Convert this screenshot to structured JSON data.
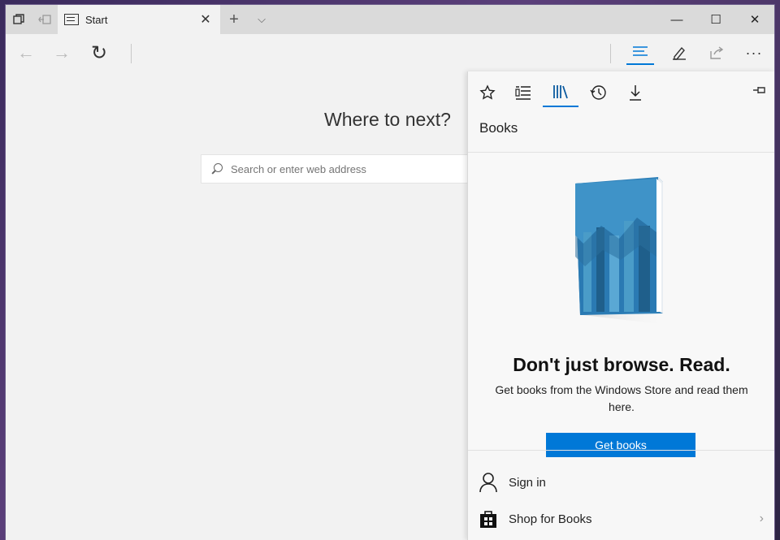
{
  "titlebar": {
    "tab_title": "Start",
    "tab_close": "✕",
    "new_tab": "+",
    "tab_menu": "⌵",
    "minimize": "—",
    "maximize": "☐",
    "close": "✕"
  },
  "navbar": {
    "back": "←",
    "forward": "→",
    "refresh": "↻",
    "hub_icon": "hub-icon",
    "notes_icon": "pen-icon",
    "share_icon": "share-icon",
    "more": "···"
  },
  "page": {
    "title": "Where to next?",
    "search_placeholder": "Search or enter web address"
  },
  "hub": {
    "tabs": [
      "favorites",
      "reading-list",
      "books",
      "history",
      "downloads"
    ],
    "heading": "Books",
    "promo_title": "Don't just browse. Read.",
    "promo_text": "Get books from the Windows Store and read them here.",
    "button_label": "Get books",
    "rows": [
      {
        "label": "Sign in",
        "icon": "person-icon"
      },
      {
        "label": "Shop for Books",
        "icon": "store-icon",
        "chevron": "›"
      }
    ]
  },
  "colors": {
    "accent": "#0078d7",
    "book_dark": "#1f5f8b",
    "book_light": "#4a9cc8"
  }
}
